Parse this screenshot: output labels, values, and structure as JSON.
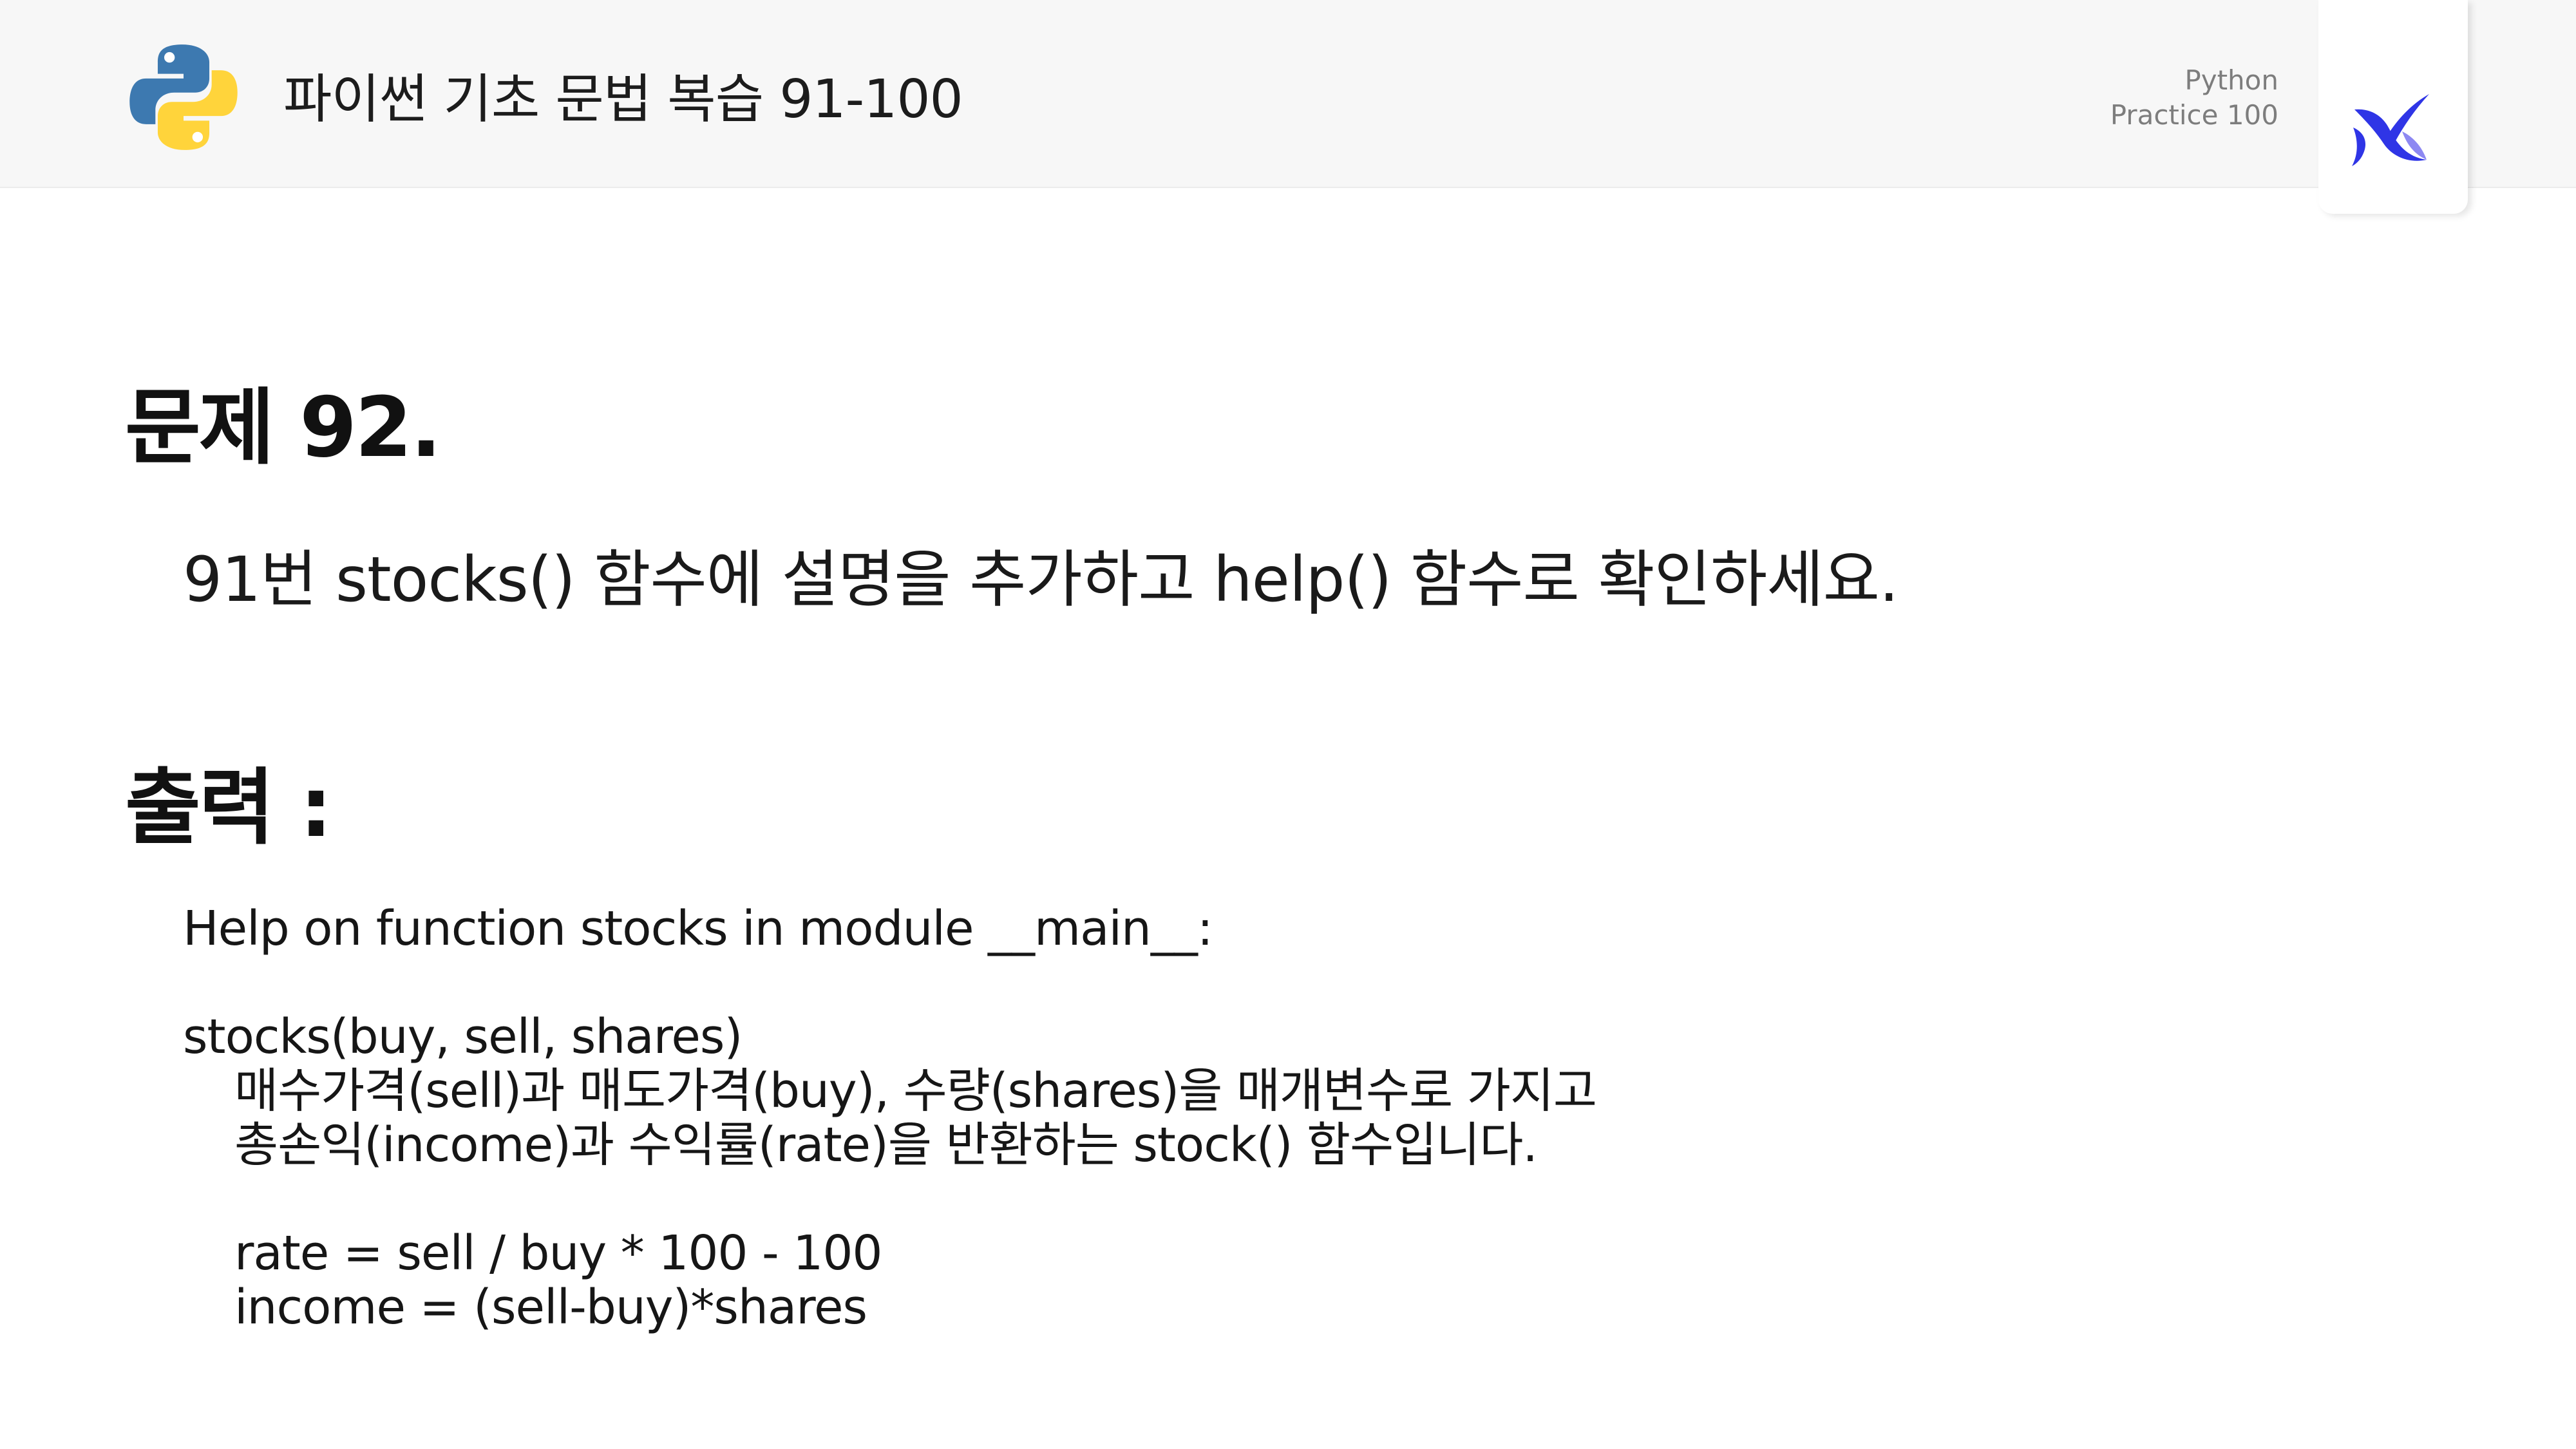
{
  "header": {
    "title": "파이썬 기초 문법 복습 91-100",
    "brand_line1": "Python",
    "brand_line2": "Practice 100",
    "colors": {
      "python_blue": "#3d79b0",
      "python_yellow": "#ffd43b",
      "brand_blue": "#2f35e6",
      "brand_light": "#8d88f2"
    }
  },
  "problem": {
    "title": "문제 92.",
    "description": "91번 stocks() 함수에 설명을 추가하고 help() 함수로 확인하세요."
  },
  "output": {
    "title": "출력 :",
    "lines": [
      "Help on function stocks in module __main__:",
      "",
      "stocks(buy, sell, shares)",
      "매수가격(sell)과 매도가격(buy), 수량(shares)을 매개변수로 가지고",
      "총손익(income)과 수익률(rate)을 반환하는 stock() 함수입니다.",
      "",
      "rate = sell / buy * 100 - 100",
      "income = (sell-buy)*shares"
    ]
  }
}
